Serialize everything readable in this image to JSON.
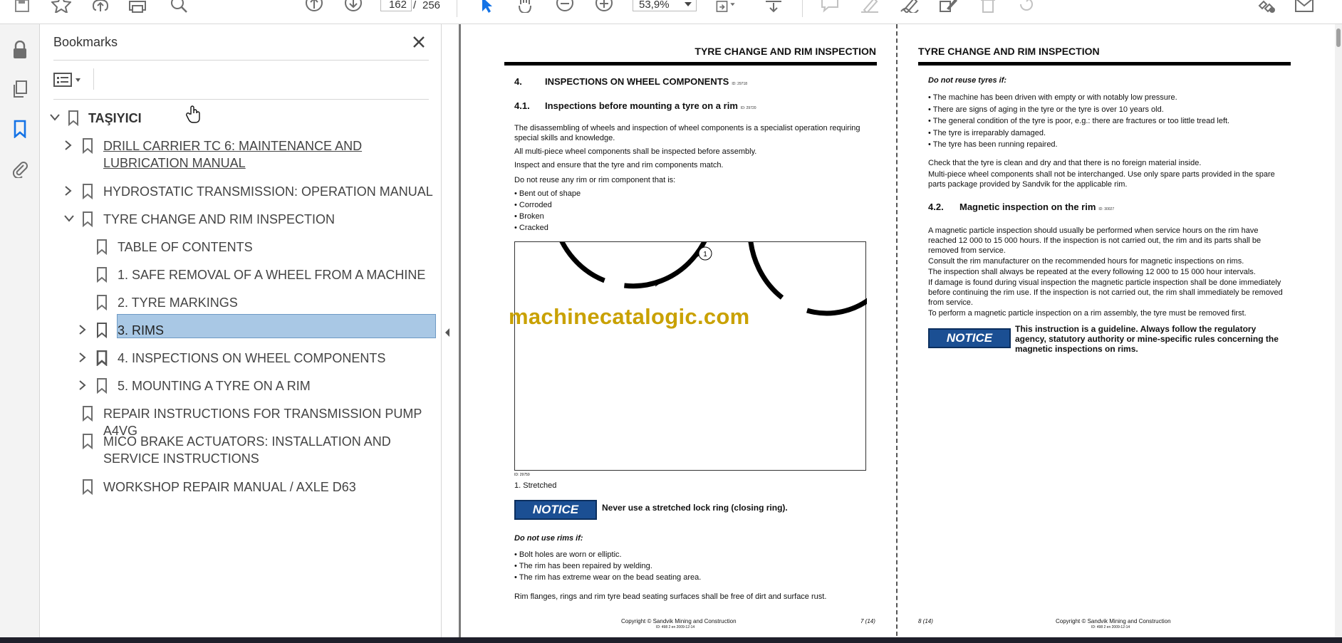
{
  "toolbar": {
    "page_current": "162",
    "page_separator": "/",
    "page_total": "256",
    "zoom": "53,9%"
  },
  "bookmarks": {
    "title": "Bookmarks",
    "items": [
      {
        "label": "TAŞIYICI"
      },
      {
        "label": "DRILL CARRIER TC 6: MAINTENANCE AND LUBRICATION MANUAL"
      },
      {
        "label": "HYDROSTATIC TRANSMISSION: OPERATION MANUAL"
      },
      {
        "label": "TYRE CHANGE AND RIM INSPECTION"
      },
      {
        "label": "TABLE OF CONTENTS"
      },
      {
        "label": "1. SAFE REMOVAL OF A WHEEL FROM A MACHINE"
      },
      {
        "label": "2. TYRE MARKINGS"
      },
      {
        "label": "3. RIMS",
        "selected": true
      },
      {
        "label": "4. INSPECTIONS ON WHEEL COMPONENTS"
      },
      {
        "label": "5. MOUNTING A TYRE ON A RIM"
      },
      {
        "label": "REPAIR INSTRUCTIONS FOR TRANSMISSION PUMP A4VG"
      },
      {
        "label": "MICO BRAKE ACTUATORS: INSTALLATION AND SERVICE INSTRUCTIONS"
      },
      {
        "label": "WORKSHOP REPAIR MANUAL / AXLE D63"
      }
    ]
  },
  "page_left": {
    "header": "TYRE CHANGE AND RIM INSPECTION",
    "section_num": "4.",
    "section_title": "INSPECTIONS ON WHEEL COMPONENTS",
    "section_id": "ID: 29718",
    "sub_num": "4.1.",
    "sub_title": "Inspections before mounting a tyre on a rim",
    "sub_id": "ID: 29720",
    "para1": "The disassembling of wheels and inspection of wheel components is a specialist operation requiring special skills and knowledge.",
    "para2": "All multi-piece wheel components shall be inspected before assembly.",
    "para3": "Inspect and ensure that the tyre and rim components match.",
    "para4": "Do not reuse any rim or rim component that is:",
    "bullets": [
      "Bent out of shape",
      "Corroded",
      "Broken",
      "Cracked"
    ],
    "figure_callout": "1",
    "figure_id": "ID: 29759",
    "figure_caption": "1.  Stretched",
    "notice_label": "NOTICE",
    "notice_text": "Never use a stretched lock ring (closing ring).",
    "subhead2": "Do not use rims if:",
    "bullets2": [
      "Bolt holes are worn or elliptic.",
      "The rim has been repaired by welding.",
      "The rim has extreme wear on the bead seating area."
    ],
    "para5": "Rim flanges, rings and rim tyre bead seating surfaces shall be free of dirt and surface rust.",
    "footer_copyright": "Copyright © Sandvik Mining and Construction",
    "footer_id": "ID: 498 2 en 2009-12-14",
    "footer_page": "7 (14)"
  },
  "page_right": {
    "header": "TYRE CHANGE AND RIM INSPECTION",
    "subhead": "Do not reuse tyres if:",
    "bullets": [
      "The machine has been driven with empty or with notably low pressure.",
      "There are signs of aging in the tyre or the tyre is over 10 years old.",
      "The general condition of the tyre is poor, e.g.: there are fractures or too little tread left.",
      "The tyre is irreparably damaged.",
      "The tyre has been running repaired."
    ],
    "para1": "Check that the tyre is clean and dry and that there is no foreign material inside.",
    "para2": "Multi-piece wheel components shall not be interchanged. Use only spare parts provided in the spare parts package provided by Sandvik for the applicable rim.",
    "sub_num": "4.2.",
    "sub_title": "Magnetic inspection on the rim",
    "sub_id": "ID: 30027",
    "para3": "A magnetic particle inspection should usually be performed when service hours on the rim have reached 12 000 to 15 000 hours. If the inspection is not carried out, the rim and its parts shall be removed from service.",
    "para4": "Consult the rim manufacturer on the recommended hours for magnetic inspections on rims.",
    "para5": "The inspection shall always be repeated at the every following 12 000 to 15 000 hour intervals.",
    "para6": "If damage is found during visual inspection the magnetic particle inspection shall be done immediately before continuing the rim use. If the inspection is not carried out, the rim shall immediately be removed from service.",
    "para7": "To perform a magnetic particle inspection on a rim assembly, the tyre must be removed first.",
    "notice_label": "NOTICE",
    "notice_text": "This instruction is a guideline. Always follow the regulatory agency, statutory authority or mine-specific rules concerning the magnetic inspections on rims.",
    "footer_page": "8 (14)",
    "footer_copyright": "Copyright © Sandvik Mining and Construction",
    "footer_id": "ID: 498 2 en 2009-12-14"
  },
  "watermark": "machinecatalogic.com",
  "colors": {
    "selected_bookmark": "#a9c8e5",
    "notice_blue": "#1b4f93",
    "toolbar_blue": "#1473e6",
    "watermark": "#c9a100"
  }
}
